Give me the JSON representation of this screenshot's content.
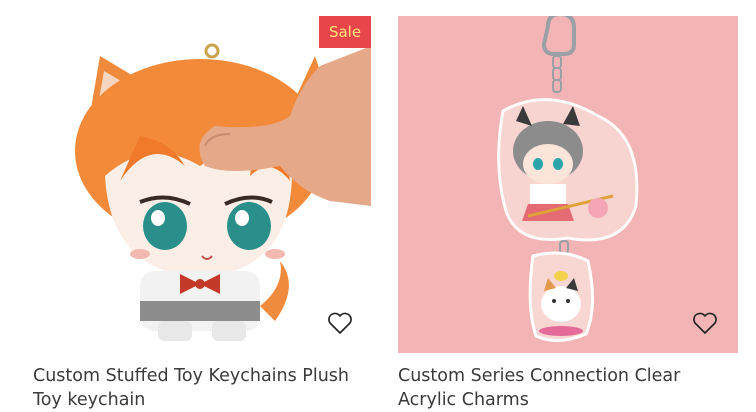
{
  "products": [
    {
      "title": "Custom Stuffed Toy Keychains Plush Toy keychain",
      "badge": "Sale",
      "wishlist_icon": "heart-outline-icon"
    },
    {
      "title": "Custom Series Connection Clear Acrylic Charms",
      "wishlist_icon": "heart-outline-icon"
    }
  ],
  "colors": {
    "sale_badge_bg": "#e8464a",
    "sale_badge_text": "#ffe27a",
    "card2_bg": "#f2b4b4",
    "title_text": "#3a3a3a"
  }
}
